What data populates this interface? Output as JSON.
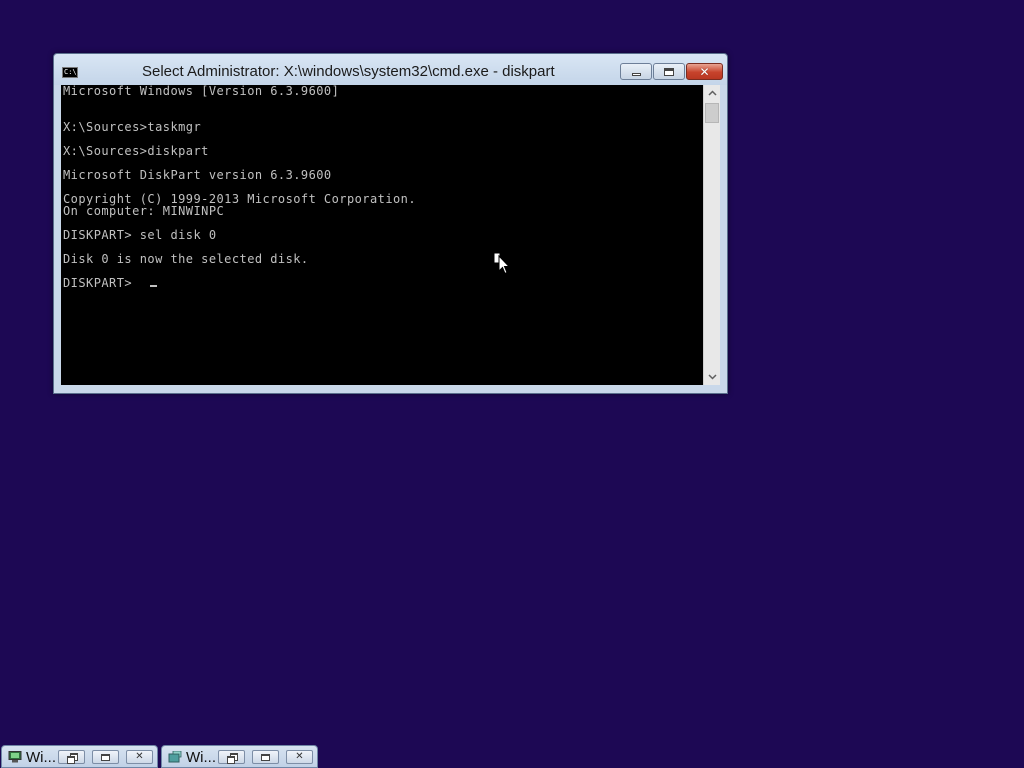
{
  "desktop": {
    "background_color": "#1d0854"
  },
  "console_window": {
    "title": "Select Administrator: X:\\windows\\system32\\cmd.exe - diskpart",
    "icon": "console-icon",
    "icon_text": "C:\\_",
    "close_glyph": "✕",
    "lines": [
      "Microsoft Windows [Version 6.3.9600]",
      "",
      "",
      "X:\\Sources>taskmgr",
      "",
      "X:\\Sources>diskpart",
      "",
      "Microsoft DiskPart version 6.3.9600",
      "",
      "Copyright (C) 1999-2013 Microsoft Corporation.",
      "On computer: MINWINPC",
      "",
      "DISKPART> sel disk 0",
      "",
      "Disk 0 is now the selected disk.",
      "",
      "DISKPART> "
    ],
    "text_color": "#c0c0c0",
    "background_color": "#000000"
  },
  "taskbar": {
    "minimized_windows": [
      {
        "title": "Wi...",
        "icon": "computer-icon",
        "close_glyph": "✕"
      },
      {
        "title": "Wi...",
        "icon": "setup-icon",
        "close_glyph": "✕"
      }
    ]
  }
}
